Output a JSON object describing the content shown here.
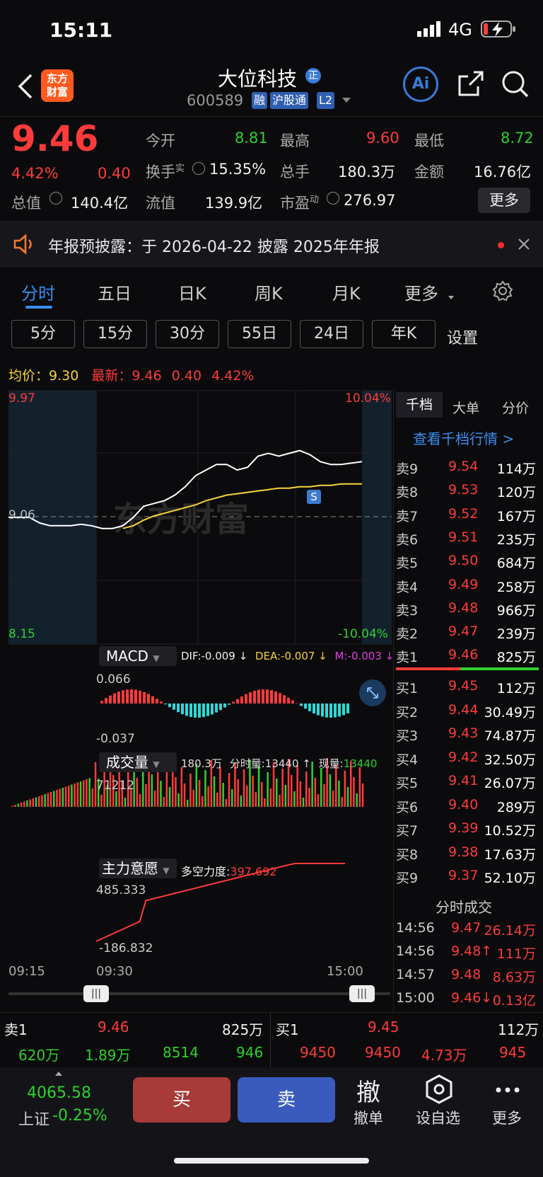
{
  "status_bar": {
    "time": "15:11",
    "network": "4G"
  },
  "header": {
    "title": "大位科技",
    "title_badge": "正",
    "code": "600589",
    "tags": [
      "融",
      "沪股通",
      "L2"
    ],
    "logo_text": "东方\n财富"
  },
  "quote": {
    "price": "9.46",
    "change_pct": "4.42%",
    "change": "0.40",
    "fields": [
      {
        "label": "今开",
        "value": "8.81",
        "color": "#2fd02f"
      },
      {
        "label": "最高",
        "value": "9.60",
        "color": "#ff3b3b"
      },
      {
        "label": "最低",
        "value": "8.72",
        "color": "#2fd02f"
      },
      {
        "label": "换手",
        "sup": "实",
        "value": "15.35%"
      },
      {
        "label": "总手",
        "value": "180.3万"
      },
      {
        "label": "金额",
        "value": "16.76亿"
      },
      {
        "label": "总值",
        "value": "140.4亿"
      },
      {
        "label": "流值",
        "value": "139.9亿"
      },
      {
        "label": "市盈",
        "sup": "动",
        "value": "276.97"
      }
    ],
    "more_button": "更多"
  },
  "notice": {
    "text": "年报预披露：于 2026-04-22 披露 2025年年报"
  },
  "tabs": [
    "分时",
    "五日",
    "日K",
    "周K",
    "月K",
    "更多"
  ],
  "sub_tabs": [
    "5分",
    "15分",
    "30分",
    "55日",
    "24日",
    "年K",
    "设置"
  ],
  "chart_header": {
    "avg_label": "均价：",
    "avg": "9.30",
    "latest_label": "最新：",
    "latest": "9.46",
    "change": "0.40",
    "change_pct": "4.42%"
  },
  "chart_data": {
    "type": "line",
    "price_axis": {
      "max": "9.97",
      "mid": "9.06",
      "min": "8.15",
      "max_pct": "10.04%",
      "min_pct": "-10.04%"
    },
    "ylim": [
      8.15,
      9.97
    ],
    "time_labels": [
      "09:15",
      "09:30",
      "15:00"
    ],
    "series": [
      {
        "name": "price",
        "values": [
          9.06,
          9.06,
          9.06,
          9.02,
          9.0,
          9.0,
          9.0,
          9.01,
          9.0,
          8.98,
          8.98,
          9.0,
          9.06,
          9.14,
          9.16,
          9.18,
          9.22,
          9.28,
          9.36,
          9.4,
          9.44,
          9.44,
          9.4,
          9.42,
          9.5,
          9.52,
          9.5,
          9.52,
          9.54,
          9.51,
          9.46,
          9.44,
          9.44,
          9.45,
          9.46
        ]
      },
      {
        "name": "avg",
        "values": [
          null,
          null,
          null,
          null,
          null,
          null,
          null,
          null,
          null,
          null,
          null,
          8.98,
          9.0,
          9.04,
          9.07,
          9.09,
          9.11,
          9.13,
          9.15,
          9.18,
          9.2,
          9.22,
          9.23,
          9.24,
          9.25,
          9.26,
          9.27,
          9.27,
          9.28,
          9.28,
          9.29,
          9.29,
          9.3,
          9.3,
          9.3
        ]
      }
    ],
    "marker": "S"
  },
  "macd": {
    "label": "MACD",
    "dif": "DIF:-0.009 ↓",
    "dea": "DEA:-0.007 ↓",
    "m": "M:-0.003 ↓",
    "top": "0.066",
    "bottom": "-0.037"
  },
  "volume": {
    "label": "成交量",
    "total": "180.3万",
    "tick_label": "分时量:",
    "tick": "13440 ↑",
    "now_label": "现量:",
    "now": "13440",
    "max": "71212"
  },
  "main_force": {
    "label": "主力意愿",
    "power_label": "多空力度:",
    "power": "397.692",
    "top": "485.333",
    "bottom": "-186.832"
  },
  "orderbook": {
    "tabs": [
      "千档",
      "大单",
      "分价"
    ],
    "view_link": "查看千档行情 >",
    "asks": [
      {
        "label": "卖9",
        "price": "9.54",
        "vol": "114万"
      },
      {
        "label": "卖8",
        "price": "9.53",
        "vol": "120万"
      },
      {
        "label": "卖7",
        "price": "9.52",
        "vol": "167万"
      },
      {
        "label": "卖6",
        "price": "9.51",
        "vol": "235万"
      },
      {
        "label": "卖5",
        "price": "9.50",
        "vol": "684万"
      },
      {
        "label": "卖4",
        "price": "9.49",
        "vol": "258万"
      },
      {
        "label": "卖3",
        "price": "9.48",
        "vol": "966万"
      },
      {
        "label": "卖2",
        "price": "9.47",
        "vol": "239万"
      },
      {
        "label": "卖1",
        "price": "9.46",
        "vol": "825万"
      }
    ],
    "bids": [
      {
        "label": "买1",
        "price": "9.45",
        "vol": "112万"
      },
      {
        "label": "买2",
        "price": "9.44",
        "vol": "30.49万"
      },
      {
        "label": "买3",
        "price": "9.43",
        "vol": "74.87万"
      },
      {
        "label": "买4",
        "price": "9.42",
        "vol": "32.50万"
      },
      {
        "label": "买5",
        "price": "9.41",
        "vol": "26.07万"
      },
      {
        "label": "买6",
        "price": "9.40",
        "vol": "289万"
      },
      {
        "label": "买7",
        "price": "9.39",
        "vol": "10.52万"
      },
      {
        "label": "买8",
        "price": "9.38",
        "vol": "17.63万"
      },
      {
        "label": "买9",
        "price": "9.37",
        "vol": "52.10万"
      }
    ],
    "trades_title": "分时成交",
    "trades": [
      {
        "time": "14:56",
        "price": "9.47",
        "vol": "26.14万"
      },
      {
        "time": "14:56",
        "price": "9.48↑",
        "vol": "111万"
      },
      {
        "time": "14:57",
        "price": "9.48",
        "vol": "8.63万"
      },
      {
        "time": "15:00",
        "price": "9.46↓",
        "vol": "0.13亿"
      }
    ]
  },
  "level_strip": {
    "sell1": {
      "label": "卖1",
      "price": "9.46",
      "vol": "825万",
      "cells": [
        "620万",
        "1.89万",
        "8514",
        "946"
      ]
    },
    "buy1": {
      "label": "买1",
      "price": "9.45",
      "vol": "112万",
      "cells": [
        "9450",
        "9450",
        "4.73万",
        "945"
      ]
    }
  },
  "bottom": {
    "index_value": "4065.58",
    "index_name": "上证",
    "index_change": "-0.25%",
    "buy": "买",
    "sell": "卖",
    "cancel_icon_text": "撤",
    "cancel": "撤单",
    "watch": "设自选",
    "more": "更多"
  }
}
